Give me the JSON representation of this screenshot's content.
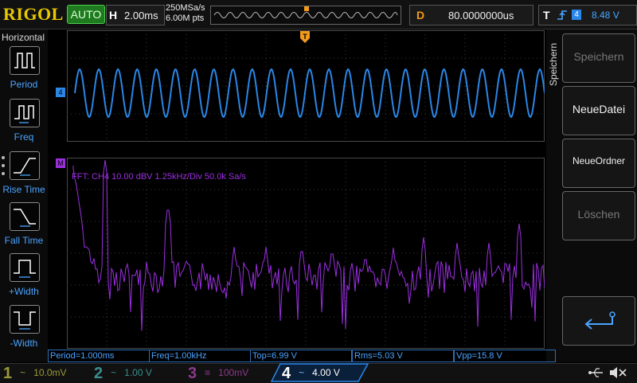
{
  "brand": "RIGOL",
  "run_mode": "AUTO",
  "timebase": {
    "label": "H",
    "value": "2.00ms"
  },
  "acquisition": {
    "sample_rate": "250MSa/s",
    "memory_depth": "6.00M pts"
  },
  "delay": {
    "label": "D",
    "value": "80.0000000us"
  },
  "trigger": {
    "label": "T",
    "source": "4",
    "level": "8.48 V"
  },
  "left_menu": {
    "title": "Horizontal",
    "items": [
      {
        "label": "Period"
      },
      {
        "label": "Freq"
      },
      {
        "label": "Rise Time"
      },
      {
        "label": "Fall Time"
      },
      {
        "label": "+Width"
      },
      {
        "label": "-Width"
      }
    ]
  },
  "markers": {
    "channel_marker": "4",
    "math_marker": "M"
  },
  "fft_info": "FFT:  CH4  10.00 dBV    1.25kHz/Div    50.0k Sa/s",
  "right_menu": {
    "title": "Speichern",
    "buttons": [
      {
        "label": "Speichern",
        "enabled": false
      },
      {
        "label": "NeueDatei",
        "enabled": true
      },
      {
        "label": "NeueOrdner",
        "enabled": true
      },
      {
        "label": "Löschen",
        "enabled": false
      }
    ]
  },
  "measurements": [
    "Period=1.000ms",
    "Freq=1.00kHz",
    "Top=6.99 V",
    "Rms=5.03 V",
    "Vpp=15.8 V"
  ],
  "channels": [
    {
      "number": "1",
      "coupling": "~",
      "scale": "10.0mV",
      "color": "#c8c800"
    },
    {
      "number": "2",
      "coupling": "~",
      "scale": "1.00 V",
      "color": "#2bbfbf"
    },
    {
      "number": "3",
      "coupling": "≡",
      "scale": "100mV",
      "color": "#c040c0"
    },
    {
      "number": "4",
      "coupling": "~",
      "scale": "4.00 V",
      "color": "#2b86e6"
    }
  ],
  "colors": {
    "ch4": "#2b86e6",
    "math": "#9b2fe0",
    "trigger": "#f29a1a",
    "grid": "#3a3a3a",
    "logo": "#e8c800"
  }
}
